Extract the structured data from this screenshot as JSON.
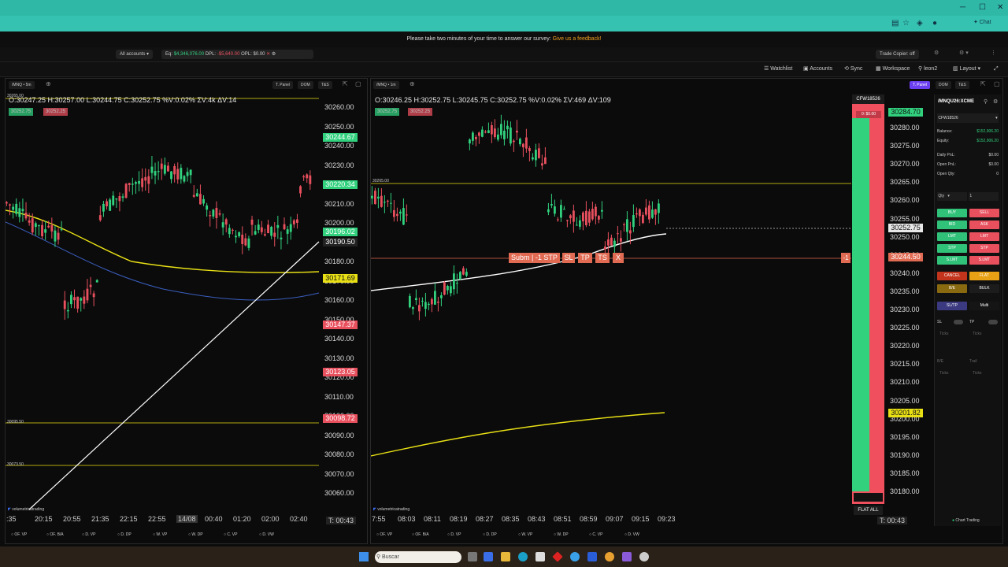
{
  "survey": {
    "text": "Please take two minutes of your time to answer our survey:",
    "link": "Give us a feedback!"
  },
  "account_bar": {
    "accounts": "All accounts",
    "eq_label": "Eq:",
    "eq_value": "$4,346,076.00",
    "dpl_label": "DPL:",
    "dpl_value": "-$5,640.00",
    "opl_label": "OPL:",
    "opl_value": "$0.00",
    "trade_copier": "Trade Copier: off"
  },
  "nav": {
    "watchlist": "Watchlist",
    "accounts": "Accounts",
    "sync": "Sync",
    "workspace": "Workspace",
    "user": "leon2",
    "layout": "Layout"
  },
  "chart_left": {
    "symbol": "/MNQ",
    "interval": "5m",
    "tab_panel": "T. Panel",
    "tab_dom": "DOM",
    "tab_ts": "T&S",
    "ohlc": "O:30247.25  H:30257.00  L:30244.75  C:30252.75  %V:0.02%  ΣV:4k  ΔV:14",
    "buy_price": "30252.75",
    "sell_price": "30252.25",
    "y_ticks": [
      "30260.00",
      "30250.00",
      "30240.00",
      "30230.00",
      "30220.00",
      "30210.00",
      "30200.00",
      "30190.00",
      "30180.00",
      "30170.00",
      "30160.00",
      "30150.00",
      "30140.00",
      "30130.00",
      "30120.00",
      "30110.00",
      "30100.00",
      "30090.00",
      "30080.00",
      "30070.00",
      "30060.00"
    ],
    "price_labels": [
      {
        "text": "30244.67",
        "color": "#31d17e"
      },
      {
        "text": "30220.34",
        "color": "#31d17e"
      },
      {
        "text": "30196.02",
        "color": "#31d17e"
      },
      {
        "text": "30190.50",
        "color": "#222222"
      },
      {
        "text": "30171.69",
        "color": "#e8e015"
      },
      {
        "text": "30147.37",
        "color": "#e8505e"
      },
      {
        "text": "30123.05",
        "color": "#e8505e"
      },
      {
        "text": "30098.72",
        "color": "#e8505e"
      }
    ],
    "level_labels": [
      "30265.00",
      "30095.50",
      "30073.50"
    ],
    "x_ticks": [
      ":35",
      "20:15",
      "20:55",
      "21:35",
      "22:15",
      "22:55",
      "14/08",
      "00:40",
      "01:20",
      "02:00",
      "02:40"
    ],
    "timer": "T: 00:43",
    "brand": "volumetricatrading",
    "footer": [
      "OF. VP",
      "OF. B/A",
      "D. VP",
      "D. DP",
      "W. VP",
      "W. DP",
      "C. VP",
      "D. VW"
    ]
  },
  "chart_right": {
    "symbol": "/MNQ",
    "interval": "1m",
    "tab_panel": "T. Panel",
    "tab_dom": "DOM",
    "tab_ts": "T&S",
    "ohlc": "O:30246.25  H:30252.75  L:30245.75  C:30252.75  %V:0.02%  ΣV:469  ΔV:109",
    "buy_price": "30252.75",
    "sell_price": "30252.25",
    "y_ticks": [
      "30280.00",
      "30275.00",
      "30270.00",
      "30265.00",
      "30260.00",
      "30255.00",
      "30250.00",
      "30245.00",
      "30240.00",
      "30235.00",
      "30230.00",
      "30225.00",
      "30220.00",
      "30215.00",
      "30210.00",
      "30205.00",
      "30200.00",
      "30195.00",
      "30190.00",
      "30185.00",
      "30180.00"
    ],
    "top_price": "30284.70",
    "last_price": "30252.75",
    "order_price": "30244.50",
    "vwap_price": "30201.82",
    "level_label": "30265.00",
    "order_bar": {
      "submit": "Subm",
      "qty": "-1 STP",
      "sl": "SL",
      "tp": "TP",
      "ts": "TS",
      "x": "X",
      "right_qty": "-1"
    },
    "x_ticks": [
      "7:55",
      "08:03",
      "08:11",
      "08:19",
      "08:27",
      "08:35",
      "08:43",
      "08:51",
      "08:59",
      "09:07",
      "09:15",
      "09:23"
    ],
    "timer": "T: 00:43",
    "dom_account": "CFW18526",
    "dom_pnl": "0: $0.00",
    "flat_all": "FLAT ALL",
    "brand": "volumetricatrading",
    "footer": [
      "OF. VP",
      "OF. B/A",
      "D. VP",
      "D. DP",
      "W. VP",
      "W. DP",
      "C. VP",
      "D. VW"
    ]
  },
  "order_panel": {
    "symbol": "/MNQU26:XCME",
    "account": "CFW18526",
    "rows": [
      {
        "label": "Balance:",
        "value": "$152,906.20"
      },
      {
        "label": "Equity:",
        "value": "$152,906.20"
      },
      {
        "label": "Daily PnL:",
        "value": "$0.00"
      },
      {
        "label": "Open PnL:",
        "value": "$0.00"
      },
      {
        "label": "Open Qty:",
        "value": "0"
      }
    ],
    "qty_label": "Qty",
    "qty_value": "1",
    "buttons": [
      [
        "BUY",
        "SELL"
      ],
      [
        "BID",
        "ASK"
      ],
      [
        "LMT",
        "LMT"
      ],
      [
        "STP",
        "STP"
      ],
      [
        "S.LMT",
        "S.LMT"
      ]
    ],
    "cancel": "CANCEL",
    "flat": "FLAT",
    "be": "B/E",
    "bulk": "BULK",
    "sltp": "SL/TP",
    "multi": "Multi",
    "sl": "SL",
    "tp": "TP",
    "ticks": "Ticks",
    "be2": "B/E",
    "trail": "Trail",
    "chart_trading": "Chart Trading"
  },
  "taskbar": {
    "search": "Buscar"
  },
  "colors": {
    "up": "#31d17e",
    "down": "#e8505e",
    "yellow": "#e8e015",
    "accent": "#2fb8a6"
  }
}
